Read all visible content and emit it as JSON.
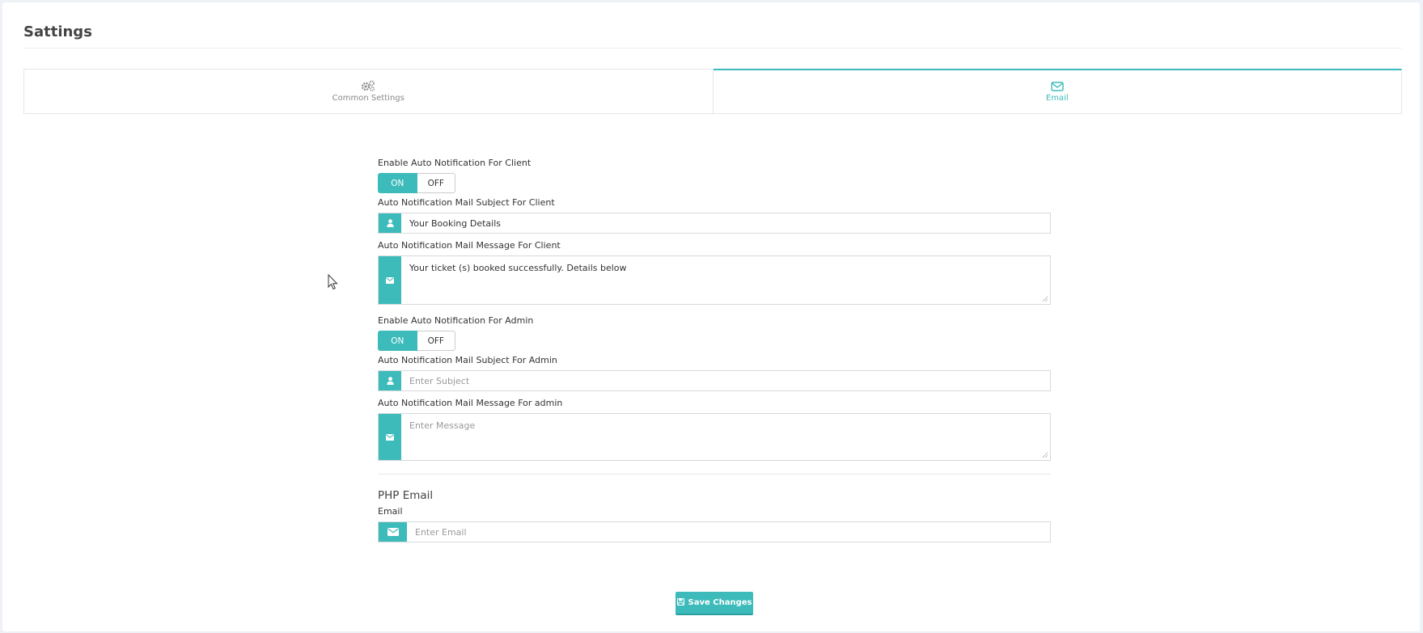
{
  "page": {
    "title": "Sattings"
  },
  "tabs": [
    {
      "label": "Common Settings",
      "icon": "gears-icon",
      "active": false
    },
    {
      "label": "Email",
      "icon": "envelope-icon",
      "active": true
    }
  ],
  "client": {
    "enable_label": "Enable Auto Notification For Client",
    "toggle_on": "ON",
    "toggle_off": "OFF",
    "selected": "ON",
    "subject_label": "Auto Notification Mail Subject For Client",
    "subject_value": "Your Booking Details",
    "message_label": "Auto Notification Mail Message For Client",
    "message_value": "Your ticket (s) booked successfully. Details below"
  },
  "admin": {
    "enable_label": "Enable Auto Notification For Admin",
    "toggle_on": "ON",
    "toggle_off": "OFF",
    "selected": "ON",
    "subject_label": "Auto Notification Mail Subject For Admin",
    "subject_placeholder": "Enter Subject",
    "message_label": "Auto Notification Mail Message For admin",
    "message_placeholder": "Enter Message"
  },
  "php_email": {
    "section_title": "PHP Email",
    "email_label": "Email",
    "email_placeholder": "Enter Email"
  },
  "actions": {
    "save_label": "Save Changes"
  },
  "colors": {
    "accent": "#3dbbbb",
    "accent_dark": "#2a9d9d",
    "background": "#eef1f5"
  }
}
